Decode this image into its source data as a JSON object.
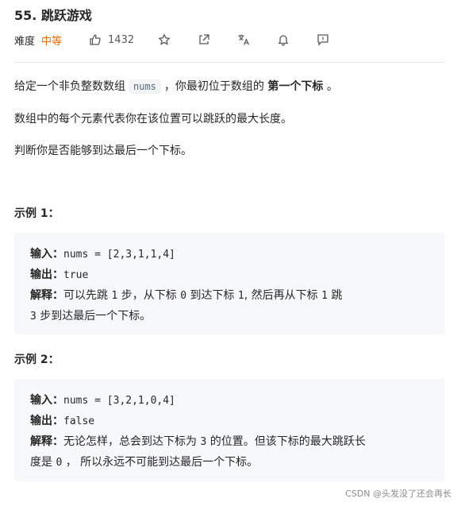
{
  "problem": {
    "title": "55. 跳跃游戏",
    "difficulty_label": "难度",
    "difficulty": "中等",
    "likes": "1432"
  },
  "icons": [
    "thumbs-up-icon",
    "star-icon",
    "share-icon",
    "translate-icon",
    "bell-icon",
    "feedback-icon"
  ],
  "colors": {
    "difficulty": "#ef6c00",
    "code_bg": "#f2f3f4",
    "block_bg": "#f7f8fa"
  },
  "description": {
    "p1_a": "给定一个非负整数数组",
    "p1_code": "nums",
    "p1_b": "，你最初位于数组的",
    "p1_bold": "第一个下标",
    "p1_c": "。",
    "p2": "数组中的每个元素代表你在该位置可以跳跃的最大长度。",
    "p3": "判断你是否能够到达最后一个下标。"
  },
  "example1": {
    "title": "示例 1：",
    "input_label": "输入：",
    "input": "nums = [2,3,1,1,4]",
    "output_label": "输出：",
    "output": "true",
    "explain_label": "解释：",
    "explain_l1_a": "可以先跳",
    "explain_l1_n1": "1",
    "explain_l1_b": "步，从下标",
    "explain_l1_n2": "0",
    "explain_l1_c": "到达下标",
    "explain_l1_n3": "1",
    "explain_l1_d": ", 然后再从下标",
    "explain_l1_n4": "1",
    "explain_l1_e": "跳",
    "explain_l2_n": "3",
    "explain_l2_a": "步到达最后一个下标。"
  },
  "example2": {
    "title": "示例 2：",
    "input_label": "输入：",
    "input": "nums = [3,2,1,0,4]",
    "output_label": "输出：",
    "output": "false",
    "explain_label": "解释：",
    "explain_l1_a": "无论怎样，总会到达下标为",
    "explain_l1_n": "3",
    "explain_l1_b": "的位置。但该下标的最大跳跃长",
    "explain_l2_a": "度是",
    "explain_l2_n": "0",
    "explain_l2_b": "，  所以永远不可能到达最后一个下标。"
  },
  "watermark": "CSDN @头发没了还会再长"
}
